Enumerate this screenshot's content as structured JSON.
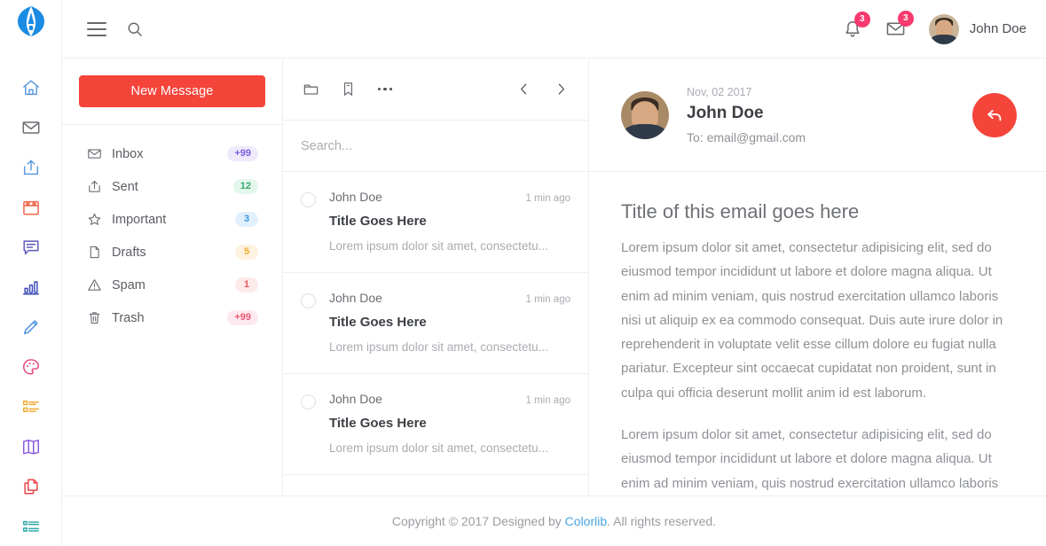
{
  "brand": {
    "logo_icon": "logo-a-icon"
  },
  "rail": {
    "items": [
      {
        "icon": "home-icon",
        "color": "#5b9ae0"
      },
      {
        "icon": "envelope-icon",
        "color": "#6b6e73"
      },
      {
        "icon": "share-icon",
        "color": "#5b9ae0"
      },
      {
        "icon": "calendar-icon",
        "color": "#f0654a"
      },
      {
        "icon": "comment-icon",
        "color": "#5e5ab8"
      },
      {
        "icon": "chart-bar-icon",
        "color": "#3f4bb8"
      },
      {
        "icon": "pencil-icon",
        "color": "#4a90e2"
      },
      {
        "icon": "palette-icon",
        "color": "#e8447a"
      },
      {
        "icon": "list-icon",
        "color": "#f0a830"
      },
      {
        "icon": "book-icon",
        "color": "#8a5ce0"
      },
      {
        "icon": "copy-icon",
        "color": "#e8454a"
      },
      {
        "icon": "list-ul-icon",
        "color": "#2aa8a8"
      }
    ]
  },
  "topbar": {
    "menu_icon": "hamburger-icon",
    "search_icon": "search-icon",
    "notifications": {
      "icon": "bell-icon",
      "count": "3"
    },
    "messages": {
      "icon": "envelope-icon",
      "count": "3"
    },
    "user": {
      "name": "John Doe",
      "avatar": "user-avatar"
    }
  },
  "folders": {
    "new_message_label": "New Message",
    "items": [
      {
        "icon": "envelope-icon",
        "label": "Inbox",
        "badge": "+99",
        "badge_style": "fb-purple"
      },
      {
        "icon": "share-icon",
        "label": "Sent",
        "badge": "12",
        "badge_style": "fb-green"
      },
      {
        "icon": "star-icon",
        "label": "Important",
        "badge": "3",
        "badge_style": "fb-blue"
      },
      {
        "icon": "file-icon",
        "label": "Drafts",
        "badge": "5",
        "badge_style": "fb-orange"
      },
      {
        "icon": "warning-icon",
        "label": "Spam",
        "badge": "1",
        "badge_style": "fb-red"
      },
      {
        "icon": "trash-icon",
        "label": "Trash",
        "badge": "+99",
        "badge_style": "fb-pink"
      }
    ]
  },
  "list": {
    "toolbar": {
      "folder_icon": "folder-icon",
      "tag_icon": "bookmark-icon",
      "more_icon": "more-dots-icon",
      "prev_icon": "chevron-left-icon",
      "next_icon": "chevron-right-icon"
    },
    "search_placeholder": "Search...",
    "search_value": "",
    "emails": [
      {
        "from": "John Doe",
        "time": "1 min ago",
        "title": "Title Goes Here",
        "preview": "Lorem ipsum dolor sit amet, consectetu..."
      },
      {
        "from": "John Doe",
        "time": "1 min ago",
        "title": "Title Goes Here",
        "preview": "Lorem ipsum dolor sit amet, consectetu..."
      },
      {
        "from": "John Doe",
        "time": "1 min ago",
        "title": "Title Goes Here",
        "preview": "Lorem ipsum dolor sit amet, consectetu..."
      }
    ]
  },
  "reader": {
    "date": "Nov, 02 2017",
    "sender": "John Doe",
    "recipient": "To: email@gmail.com",
    "reply_icon": "reply-icon",
    "title": "Title of this email goes here",
    "paragraphs": [
      "Lorem ipsum dolor sit amet, consectetur adipisicing elit, sed do eiusmod tempor incididunt ut labore et dolore magna aliqua. Ut enim ad minim veniam, quis nostrud exercitation ullamco laboris nisi ut aliquip ex ea commodo consequat. Duis aute irure dolor in reprehenderit in voluptate velit esse cillum dolore eu fugiat nulla pariatur. Excepteur sint occaecat cupidatat non proident, sunt in culpa qui officia deserunt mollit anim id est laborum.",
      "Lorem ipsum dolor sit amet, consectetur adipisicing elit, sed do eiusmod tempor incididunt ut labore et dolore magna aliqua. Ut enim ad minim veniam, quis nostrud exercitation ullamco laboris nisi ut aliquip ex ea commodo consequat."
    ]
  },
  "footer": {
    "prefix": "Copyright © 2017 Designed by ",
    "link": "Colorlib",
    "suffix": ". All rights reserved."
  },
  "colors": {
    "accent_red": "#f5443a",
    "badge_pink": "#f7396e",
    "link_blue": "#4ba3e3",
    "border": "#eceef1"
  }
}
